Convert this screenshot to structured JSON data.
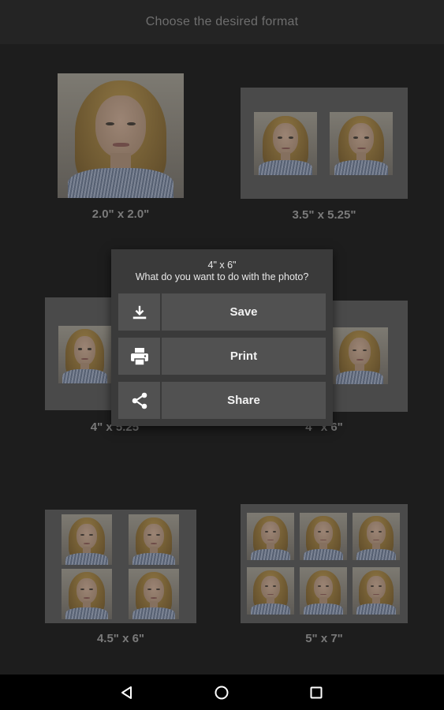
{
  "header": {
    "title": "Choose the desired format"
  },
  "formats": [
    {
      "label": "2.0\" x 2.0\""
    },
    {
      "label": "3.5\" x 5.25\""
    },
    {
      "label": "4\" x 5.25\""
    },
    {
      "label": "4\" x 6\""
    },
    {
      "label": "4.5\" x 6\""
    },
    {
      "label": "5\" x 7\""
    }
  ],
  "dialog": {
    "title": "4\" x 6\"",
    "subtitle": "What do you want to do with the photo?",
    "actions": [
      {
        "label": "Save",
        "icon": "download-icon"
      },
      {
        "label": "Print",
        "icon": "printer-icon"
      },
      {
        "label": "Share",
        "icon": "share-icon"
      }
    ]
  },
  "navbar": {
    "buttons": [
      "back-icon",
      "home-icon",
      "recents-icon"
    ]
  }
}
